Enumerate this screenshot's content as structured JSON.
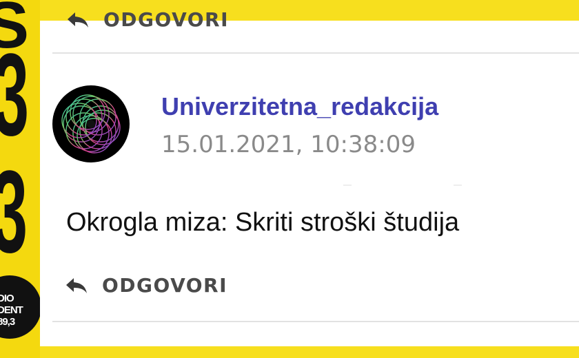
{
  "background": {
    "accent_color": "#f7df1e",
    "side_glyphs": [
      "Š",
      "3",
      "3"
    ],
    "radio_logo_lines": [
      "DIO",
      "DENT",
      "89,3"
    ]
  },
  "comment": {
    "author": "Univerzitetna_redakcija",
    "timestamp": "15.01.2021, 10:38:09",
    "text": "Okrogla miza: Skriti stroški študija",
    "avatar_icon": "spirograph-avatar-icon",
    "author_color": "#3f3fb0"
  },
  "actions": {
    "reply_label_top": "ODGOVORI",
    "reply_label": "ODGOVORI",
    "reply_icon": "reply-arrow-icon"
  }
}
